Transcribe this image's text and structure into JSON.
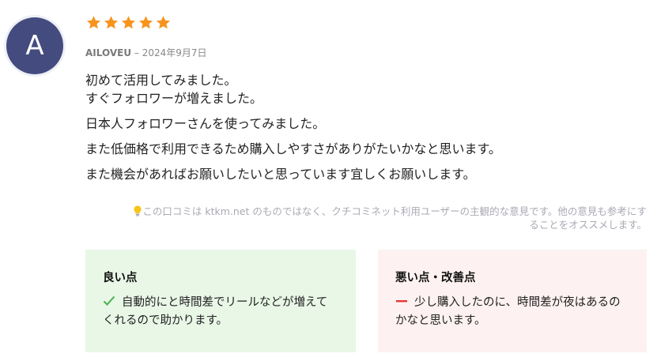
{
  "review": {
    "avatar_letter": "A",
    "rating": 5,
    "rating_max": 5,
    "author": "AILOVEU",
    "separator": " – ",
    "date": "2024年9月7日",
    "paragraphs": {
      "p1_line1": "初めて活用してみました。",
      "p1_line2": "すぐフォロワーが増えました。",
      "p2": "日本人フォロワーさんを使ってみました。",
      "p3": "また低価格で利用できるため購入しやすさがありがたいかなと思います。",
      "p4": "また機会があればお願いしたいと思っています宜しくお願いします。"
    },
    "disclaimer_line1": "この口コミは ktkm.net のものではなく、クチコミネット利用ユーザーの主観的な意見です。他の意見も参考にす",
    "disclaimer_line2": "ることをオススメします。"
  },
  "pros": {
    "title": "良い点",
    "text": "自動的にと時間差でリールなどが増えてくれるので助かります。"
  },
  "cons": {
    "title": "悪い点・改善点",
    "text": "少し購入したのに、時間差が夜はあるのかなと思います。"
  },
  "colors": {
    "star": "#f7941d",
    "avatar_bg": "#444b7e",
    "pros_bg": "#e8f7e6",
    "cons_bg": "#fdf1f1",
    "check": "#4caf50",
    "minus": "#e53935",
    "bulb": "#f5c518"
  }
}
